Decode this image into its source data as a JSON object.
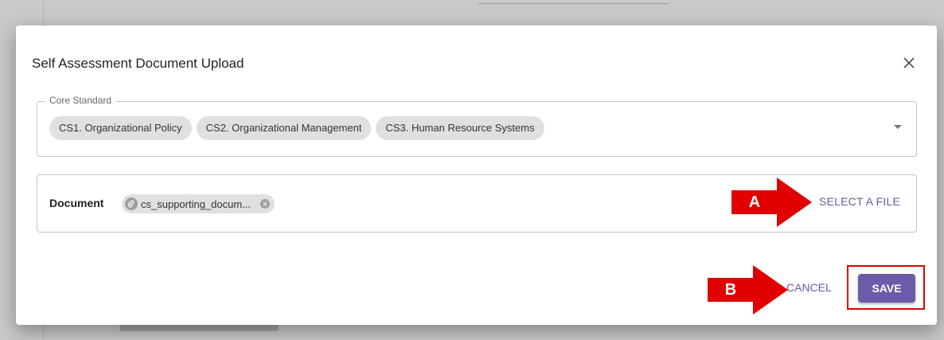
{
  "dialog": {
    "title": "Self Assessment Document Upload",
    "close_icon": "close-icon"
  },
  "core_standard": {
    "label": "Core Standard",
    "chips": [
      "CS1. Organizational Policy",
      "CS2. Organizational Management",
      "CS3. Human Resource Systems"
    ],
    "dropdown_icon": "caret-down-icon"
  },
  "document": {
    "label": "Document",
    "file_name": "cs_supporting_docum...",
    "file_icon": "paperclip-icon",
    "remove_icon": "cancel-circle-icon",
    "select_label": "SELECT A FILE"
  },
  "actions": {
    "cancel_label": "CANCEL",
    "save_label": "SAVE"
  },
  "annotations": {
    "a": "A",
    "b": "B"
  },
  "colors": {
    "accent": "#6b5ba8",
    "annotation_red": "#e00000",
    "chip_bg": "#e0e0e0"
  }
}
